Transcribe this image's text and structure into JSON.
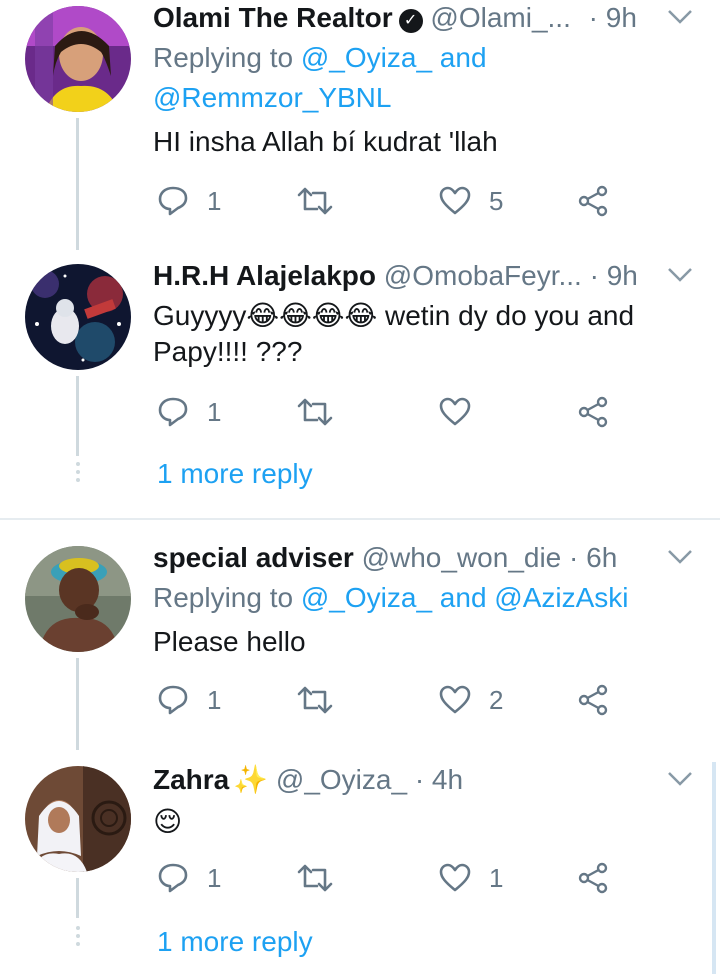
{
  "tweets": [
    {
      "name": "Olami The Realtor",
      "verified": true,
      "verified_mark": "✓",
      "handle": "@Olami_...",
      "time": "· 9h",
      "replying_prefix": "Replying to ",
      "replying_link1": "@_Oyiza_",
      "replying_and": " and",
      "replying_link2": "@Remmzor_YBNL",
      "text": "HI insha Allah bí kudrat 'llah",
      "reply_count": "1",
      "like_count": "5"
    },
    {
      "name": "H.R.H Alajelakpo",
      "handle": "@OmobaFeyr...",
      "time": "· 9h",
      "text": "Guyyyy😂😂😂😂 wetin dy do you and Papy!!!! ???",
      "reply_count": "1",
      "like_count": "",
      "more_replies": "1 more reply"
    },
    {
      "name": "special adviser",
      "handle": "@who_won_die",
      "time": "· 6h",
      "replying_prefix": "Replying to ",
      "replying_link1": "@_Oyiza_",
      "replying_and": " and ",
      "replying_link2": "@AzizAski",
      "text": "Please hello",
      "reply_count": "1",
      "like_count": "2"
    },
    {
      "name": "Zahra",
      "name_emoji": "✨",
      "handle": "@_Oyiza_",
      "time": "· 4h",
      "text": "😌",
      "reply_count": "1",
      "like_count": "1",
      "more_replies": "1 more reply"
    }
  ],
  "icons": {
    "reply": "reply-icon",
    "retweet": "retweet-icon",
    "like": "heart-icon",
    "share": "share-icon",
    "menu": "chevron-down-icon"
  },
  "colors": {
    "link": "#1da1f2",
    "secondary": "#657786",
    "thread_line": "#cfd9de"
  }
}
